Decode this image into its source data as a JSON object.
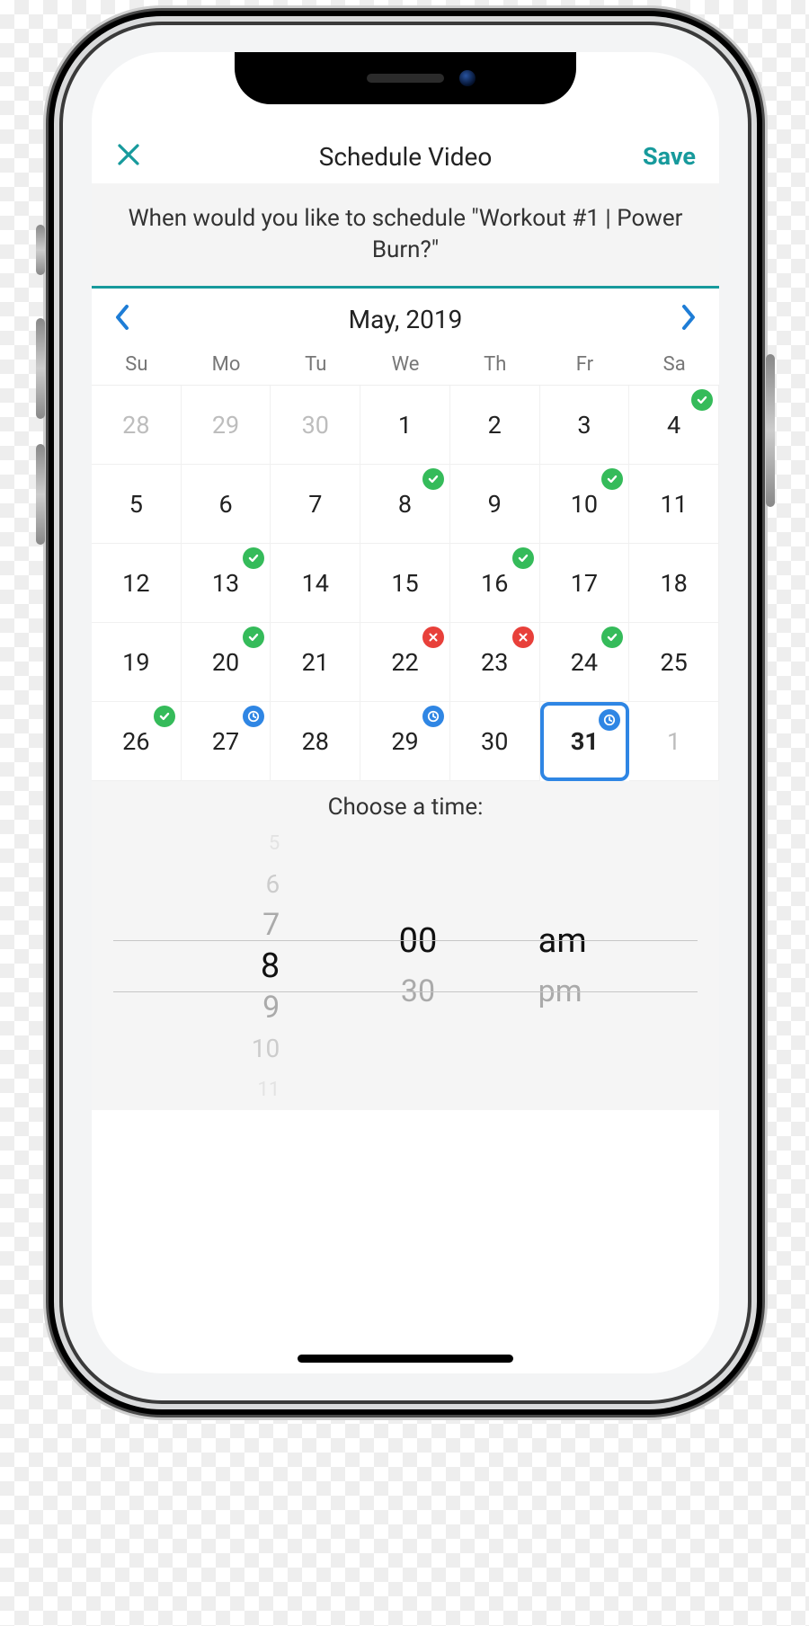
{
  "navbar": {
    "title": "Schedule Video",
    "save_label": "Save"
  },
  "prompt": "When would you like to schedule \"Workout #1 | Power Burn?\"",
  "month": {
    "label": "May, 2019",
    "dow": [
      "Su",
      "Mo",
      "Tu",
      "We",
      "Th",
      "Fr",
      "Sa"
    ]
  },
  "calendar": {
    "selected_day": 31,
    "weeks": [
      [
        {
          "n": 28,
          "other": true
        },
        {
          "n": 29,
          "other": true
        },
        {
          "n": 30,
          "other": true
        },
        {
          "n": 1
        },
        {
          "n": 2
        },
        {
          "n": 3
        },
        {
          "n": 4,
          "badge": "green"
        }
      ],
      [
        {
          "n": 5
        },
        {
          "n": 6
        },
        {
          "n": 7
        },
        {
          "n": 8,
          "badge": "green"
        },
        {
          "n": 9
        },
        {
          "n": 10,
          "badge": "green"
        },
        {
          "n": 11
        }
      ],
      [
        {
          "n": 12
        },
        {
          "n": 13,
          "badge": "green"
        },
        {
          "n": 14
        },
        {
          "n": 15
        },
        {
          "n": 16,
          "badge": "green"
        },
        {
          "n": 17
        },
        {
          "n": 18
        }
      ],
      [
        {
          "n": 19
        },
        {
          "n": 20,
          "badge": "green"
        },
        {
          "n": 21
        },
        {
          "n": 22,
          "badge": "red"
        },
        {
          "n": 23,
          "badge": "red"
        },
        {
          "n": 24,
          "badge": "green"
        },
        {
          "n": 25
        }
      ],
      [
        {
          "n": 26,
          "badge": "green"
        },
        {
          "n": 27,
          "badge": "blue"
        },
        {
          "n": 28
        },
        {
          "n": 29,
          "badge": "blue"
        },
        {
          "n": 30
        },
        {
          "n": 31,
          "badge": "blue",
          "selected": true
        },
        {
          "n": 1,
          "other": true
        }
      ]
    ]
  },
  "time": {
    "title": "Choose a time:",
    "hour_options": [
      "5",
      "6",
      "7",
      "8",
      "9",
      "10",
      "11"
    ],
    "hour_selected": "8",
    "minute_options": [
      "00",
      "30"
    ],
    "minute_selected": "00",
    "period_options": [
      "am",
      "pm"
    ],
    "period_selected": "am"
  }
}
